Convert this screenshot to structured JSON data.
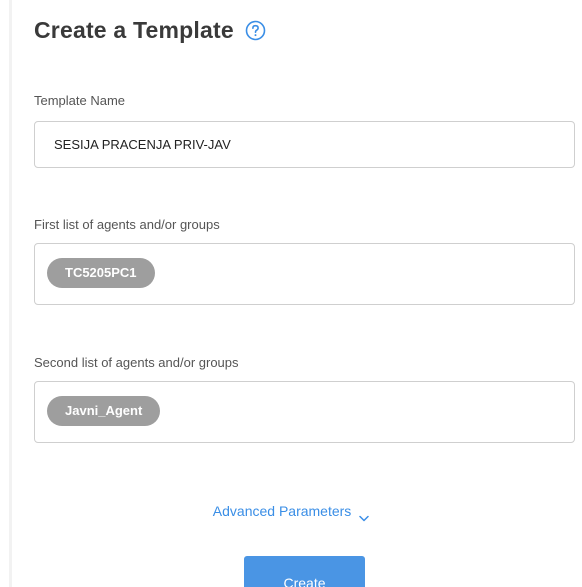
{
  "header": {
    "title": "Create a Template"
  },
  "form": {
    "template_name": {
      "label": "Template Name",
      "value": "SESIJA PRACENJA PRIV-JAV"
    },
    "first_list": {
      "label": "First list of agents and/or groups",
      "chips": [
        "TC5205PC1"
      ]
    },
    "second_list": {
      "label": "Second list of agents and/or groups",
      "chips": [
        "Javni_Agent"
      ]
    }
  },
  "advanced": {
    "label": "Advanced Parameters"
  },
  "actions": {
    "create_label": "Create"
  },
  "colors": {
    "accent": "#4a95e4",
    "link": "#3a8ee6",
    "chip": "#9e9e9e",
    "border": "#cfcfcf"
  },
  "icons": {
    "help": "question-circle-icon",
    "expand": "chevron-down-icon"
  }
}
